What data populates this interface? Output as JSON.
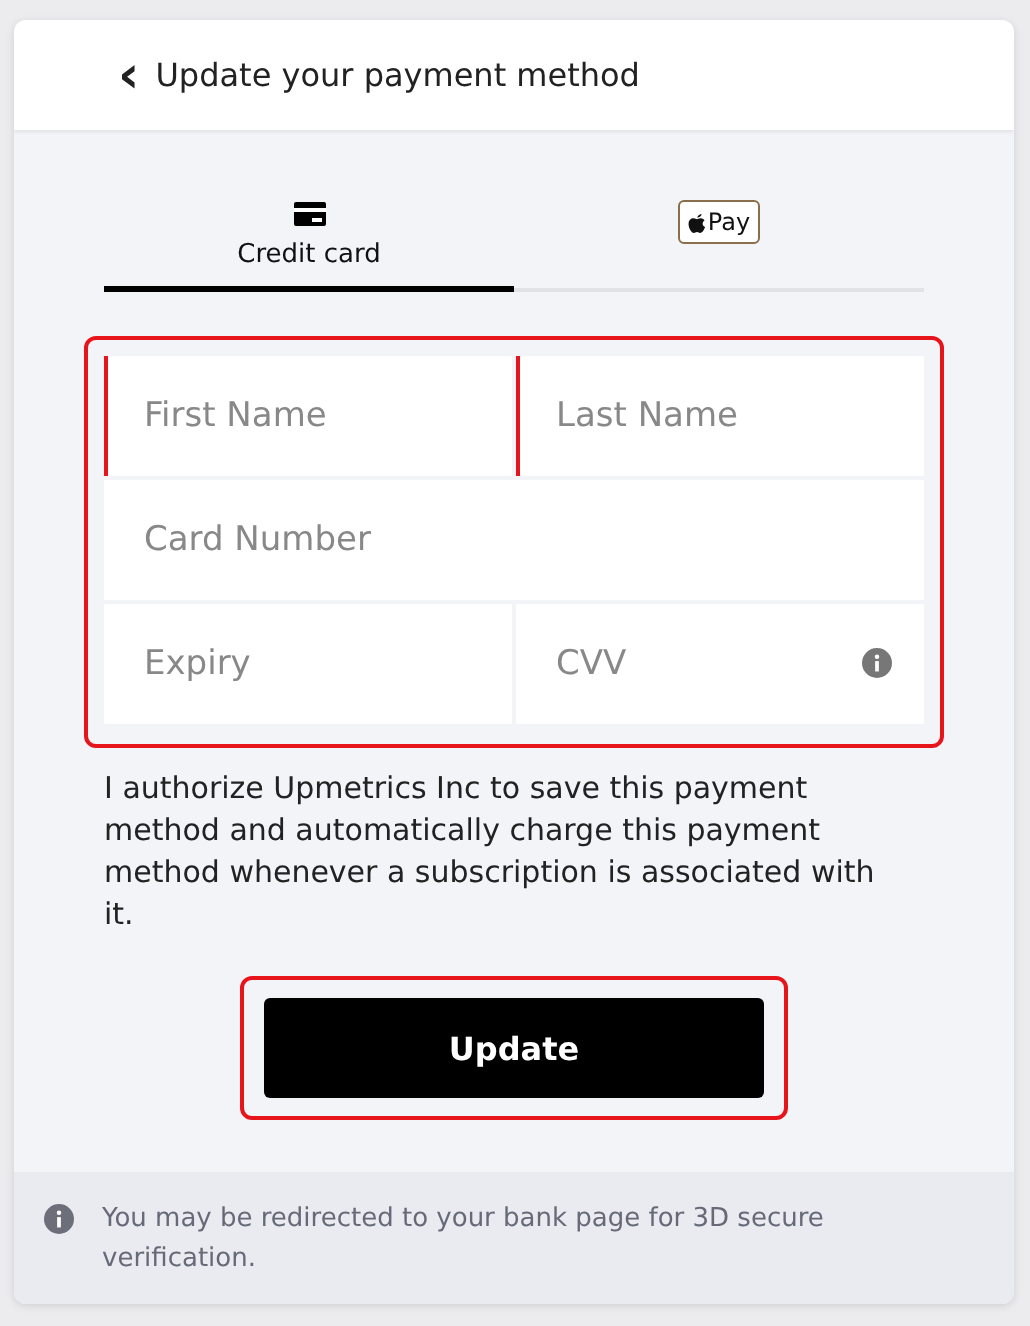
{
  "header": {
    "back": "‹",
    "title": "Update your payment method"
  },
  "tabs": [
    {
      "kind": "card",
      "label": "Credit card",
      "selected": true
    },
    {
      "kind": "wallet",
      "label": "Pay",
      "selected": false
    }
  ],
  "form": {
    "highlighted": true,
    "rows": [
      [
        {
          "placeholder": "First Name",
          "invalid": true
        },
        {
          "placeholder": "Last Name",
          "invalid": true
        }
      ],
      [
        {
          "placeholder": "Card Number",
          "invalid": false
        }
      ],
      [
        {
          "placeholder": "Expiry",
          "invalid": false
        },
        {
          "placeholder": "CVV",
          "invalid": false,
          "info": true
        }
      ]
    ]
  },
  "consent": "I authorize Upmetrics Inc to save this payment method and automatically charge this payment method whenever a subscription is associated with it.",
  "submit": {
    "label": "Update",
    "highlighted": true
  },
  "notice": "You may be redirected to your bank page for 3D secure verification."
}
